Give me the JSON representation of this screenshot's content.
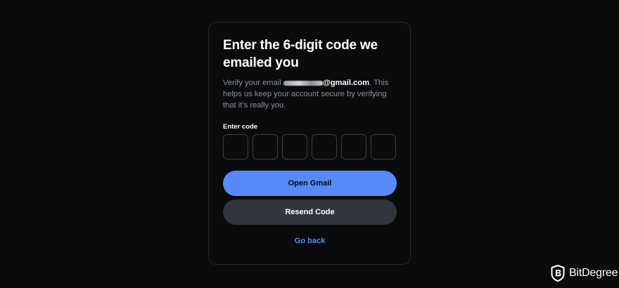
{
  "card": {
    "title": "Enter the 6-digit code we emailed you",
    "description_prefix": "Verify your email ",
    "email_domain": "@gmail.com",
    "description_suffix": ". This helps us keep your account secure by verifying that it’s really you.",
    "code_label": "Enter code",
    "code_inputs": [
      "",
      "",
      "",
      "",
      "",
      ""
    ],
    "primary_button": "Open Gmail",
    "secondary_button": "Resend Code",
    "back_link": "Go back"
  },
  "brand": {
    "icon": "bitdegree-logo-icon",
    "name": "BitDegree"
  },
  "colors": {
    "background": "#0a0b0d",
    "accent": "#588af7",
    "secondary_button": "#32353d",
    "muted_text": "#8a919e"
  }
}
